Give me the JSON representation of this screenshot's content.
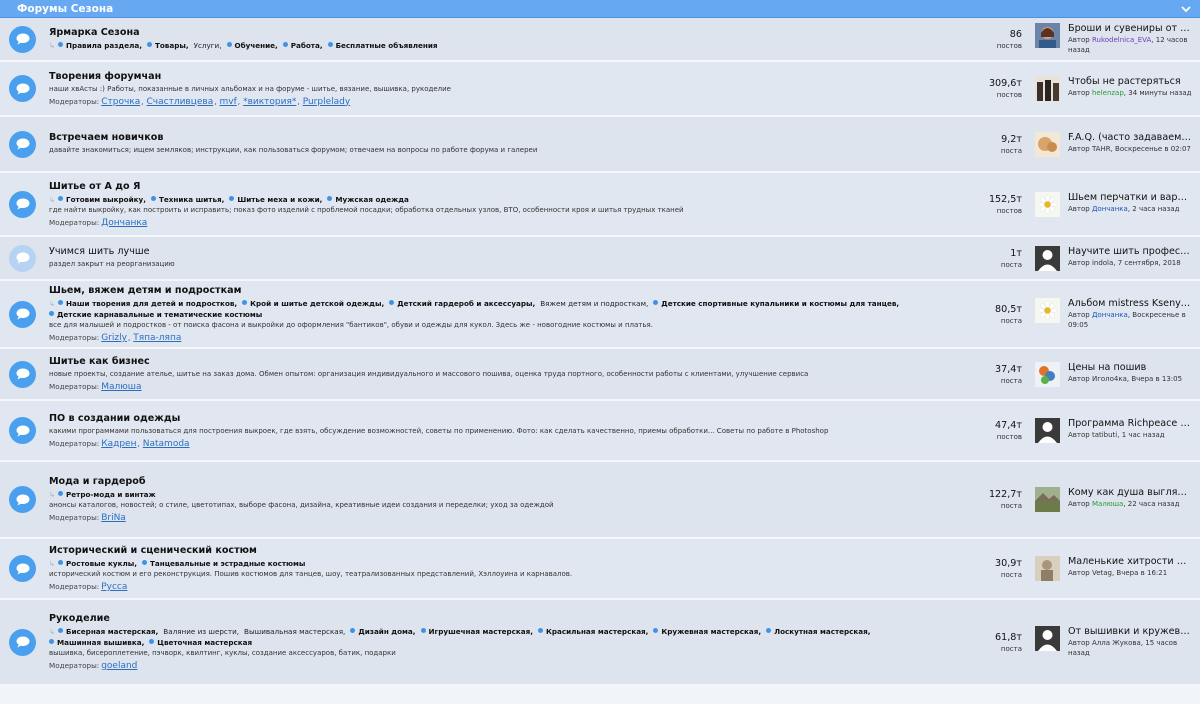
{
  "header": {
    "title": "Форумы Сезона"
  },
  "forums": [
    {
      "title": "Ярмарка Сезона",
      "subforums": [
        {
          "label": "Правила раздела,",
          "bold": true
        },
        {
          "label": "Товары,",
          "bold": true
        },
        {
          "label": "Услуги,",
          "bold": false,
          "nodot": true
        },
        {
          "label": "Обучение,",
          "bold": true
        },
        {
          "label": "Работа,",
          "bold": true
        },
        {
          "label": "Бесплатные объявления",
          "bold": true
        }
      ],
      "desc": "",
      "mods_label": "",
      "mods": [],
      "count": "86",
      "count_label": "постов",
      "last_title": "Броши и сувениры от Ru...",
      "last_prefix": "Автор ",
      "last_author": "Rukodelnica_EVA",
      "last_time": ", 12 часов назад",
      "author_color": "purple",
      "thumb": "photo-brown"
    },
    {
      "title": "Творения форумчан",
      "subforums": [],
      "desc": "наши хвАсты :) Работы, показанные в личных альбомах и на форуме - шитье, вязание, вышивка, рукоделие",
      "mods_label": "Модераторы:",
      "mods": [
        "Строчка",
        "Счастливцева",
        "mvf",
        "*виктория*",
        "Purplelady"
      ],
      "count": "309,6т",
      "count_label": "постов",
      "last_title": "Чтобы не растеряться",
      "last_prefix": "Автор ",
      "last_author": "helenzap",
      "last_time": ", 34 минуты назад",
      "author_color": "green",
      "thumb": "photo-people"
    },
    {
      "title": "Встречаем новичков",
      "subforums": [],
      "desc": "давайте знакомиться; ищем земляков; инструкции, как пользоваться форумом; отвечаем на вопросы по работе форума и галереи",
      "mods_label": "",
      "mods": [],
      "count": "9,2т",
      "count_label": "поста",
      "last_title": "F.A.Q. (часто задаваемы...",
      "last_prefix": "Автор ",
      "last_author": "TAHR",
      "last_time": ", Воскресенье в 02:07",
      "author_color": "plain",
      "thumb": "photo-cake"
    },
    {
      "title": "Шитье от А до Я",
      "subforums": [
        {
          "label": "Готовим выкройку,",
          "bold": true
        },
        {
          "label": "Техника шитья,",
          "bold": true
        },
        {
          "label": "Шитье меха и кожи,",
          "bold": true
        },
        {
          "label": "Мужская одежда",
          "bold": true
        }
      ],
      "desc": "где найти выкройку, как построить и исправить; показ фото изделий с проблемой посадки; обработка отдельных узлов, ВТО, особенности кроя и шитья трудных тканей",
      "mods_label": "Модераторы:",
      "mods": [
        "Дончанка"
      ],
      "count": "152,5т",
      "count_label": "постов",
      "last_title": "Шьем перчатки и вареж...",
      "last_prefix": "Автор ",
      "last_author": "Дончанка",
      "last_time": ", 2 часа назад",
      "author_color": "blue",
      "thumb": "photo-daisy"
    },
    {
      "title": "Учимся шить лучше",
      "closed": true,
      "subforums": [],
      "desc": "раздел закрыт на реорганизацию",
      "mods_label": "",
      "mods": [],
      "count": "1т",
      "count_label": "поста",
      "last_title": "Научите шить професси...",
      "last_prefix": "Автор ",
      "last_author": "indola",
      "last_time": ", 7 сентября, 2018",
      "author_color": "plain",
      "thumb": "avatar-default"
    },
    {
      "title": "Шьем, вяжем детям и подросткам",
      "subforums": [
        {
          "label": "Наши творения для детей и подростков,",
          "bold": true
        },
        {
          "label": "Крой и шитье детской одежды,",
          "bold": true
        },
        {
          "label": "Детский гардероб и аксессуары,",
          "bold": true
        },
        {
          "label": "Вяжем детям и подросткам,",
          "bold": false,
          "nodot": true
        },
        {
          "label": "Детские спортивные купальники и костюмы для танцев,",
          "bold": true
        },
        {
          "label": "Детские карнавальные и тематические костюмы",
          "bold": true
        }
      ],
      "desc": "все для малышей и подростков - от поиска фасона и выкройки до оформления \"бантиков\", обуви и одежды для кукол. Здесь же - новогодние костюмы и платья.",
      "mods_label": "Модераторы:",
      "mods": [
        "Grizly",
        "Тяпа-ляпа"
      ],
      "count": "80,5т",
      "count_label": "поста",
      "last_title": "Альбом mistress Kseny-D...",
      "last_prefix": "Автор ",
      "last_author": "Дончанка",
      "last_time": ", Воскресенье в 09:05",
      "author_color": "blue",
      "thumb": "photo-daisy"
    },
    {
      "title": "Шитье как бизнес",
      "subforums": [],
      "desc": "новые проекты, создание ателье, шитье на заказ дома. Обмен опытом: организация индивидуального и массового пошива, оценка труда портного, особенности работы с клиентами, улучшение сервиса",
      "mods_label": "Модераторы:",
      "mods": [
        "Малюша"
      ],
      "count": "37,4т",
      "count_label": "поста",
      "last_title": "Цены на пошив",
      "last_prefix": "Автор ",
      "last_author": "Иголо4ка",
      "last_time": ", Вчера в 13:05",
      "author_color": "plain",
      "thumb": "photo-colorful"
    },
    {
      "title": "ПО в создании одежды",
      "subforums": [],
      "desc": "какими программами пользоваться для построения выкроек, где взять, обсуждение возможностей, советы по применению. Фото: как сделать качественно, приемы обработки... Советы по работе в Photoshop",
      "mods_label": "Модераторы:",
      "mods": [
        "Кадрен",
        "Natamoda"
      ],
      "count": "47,4т",
      "count_label": "постов",
      "last_title": "Программа Richpeace CAD",
      "last_prefix": "Автор ",
      "last_author": "tatibuti",
      "last_time": ", 1 час назад",
      "author_color": "plain",
      "thumb": "avatar-default"
    },
    {
      "title": "Мода и гардероб",
      "subforums": [
        {
          "label": "Ретро-мода и винтаж",
          "bold": true
        }
      ],
      "desc": "анонсы каталогов, новостей; о стиле, цветотипах, выборе фасона, дизайна, креативные идеи создания и переделки; уход за одеждой",
      "mods_label": "Модераторы:",
      "mods": [
        "BriNa"
      ],
      "count": "122,7т",
      "count_label": "поста",
      "last_title": "Кому как душа выглядет...",
      "last_prefix": "Автор ",
      "last_author": "Малюша",
      "last_time": ", 22 часа назад",
      "author_color": "green",
      "thumb": "photo-landscape"
    },
    {
      "title": "Исторический и сценический костюм",
      "subforums": [
        {
          "label": "Ростовые куклы,",
          "bold": true
        },
        {
          "label": "Танцевальные и эстрадные костюмы",
          "bold": true
        }
      ],
      "desc": "исторический костюм и его реконструкция. Пошив костюмов для танцев, шоу, театрализованных представлений, Хэллоуина и карнавалов.",
      "mods_label": "Модераторы:",
      "mods": [
        "Русса"
      ],
      "count": "30,9т",
      "count_label": "поста",
      "last_title": "Маленькие хитрости пор...",
      "last_prefix": "Автор ",
      "last_author": "Vetag",
      "last_time": ", Вчера в 16:21",
      "author_color": "plain",
      "thumb": "photo-sepia"
    },
    {
      "title": "Рукоделие",
      "subforums": [
        {
          "label": "Бисерная мастерская,",
          "bold": true
        },
        {
          "label": "Валяние из шерсти,",
          "bold": false,
          "nodot": true
        },
        {
          "label": "Вышивальная мастерская,",
          "bold": false,
          "nodot": true
        },
        {
          "label": "Дизайн дома,",
          "bold": true
        },
        {
          "label": "Игрушечная мастерская,",
          "bold": true
        },
        {
          "label": "Красильная мастерская,",
          "bold": true
        },
        {
          "label": "Кружевная мастерская,",
          "bold": true
        },
        {
          "label": "Лоскутная мастерская,",
          "bold": true
        },
        {
          "label": "Машинная вышивка,",
          "bold": true
        },
        {
          "label": "Цветочная мастерская",
          "bold": true
        }
      ],
      "desc": "вышивка, бисероплетение, пэчворк, квилтинг, куклы, создание аксессуаров, батик, подарки",
      "mods_label": "Модераторы:",
      "mods": [
        "goeland"
      ],
      "count": "61,8т",
      "count_label": "поста",
      "last_title": "От вышивки и кружева к...",
      "last_prefix": "Автор ",
      "last_author": "Алла Жукова",
      "last_time": ", 15 часов назад",
      "author_color": "plain",
      "thumb": "avatar-default"
    }
  ]
}
